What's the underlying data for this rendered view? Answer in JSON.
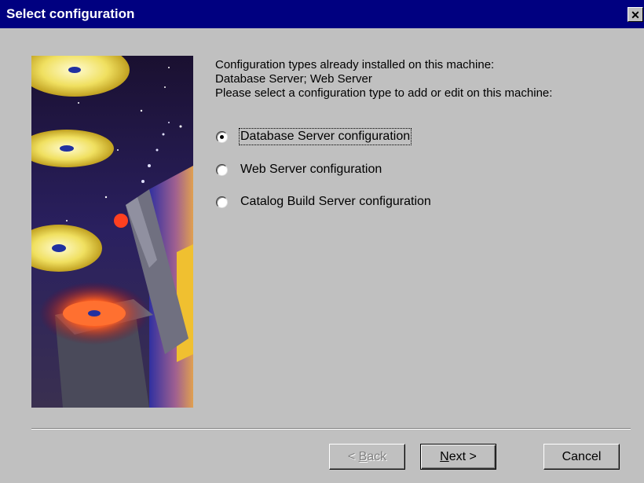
{
  "window": {
    "title": "Select configuration",
    "close_symbol": "✕"
  },
  "intro": {
    "line1": "Configuration types already installed on this machine:",
    "line2": "Database Server; Web Server",
    "line3": "Please select a configuration type to add or edit on this machine:"
  },
  "options": [
    {
      "label": "Database Server configuration",
      "checked": true
    },
    {
      "label": "Web Server configuration",
      "checked": false
    },
    {
      "label": "Catalog Build Server configuration",
      "checked": false
    }
  ],
  "buttons": {
    "back_prefix": "< ",
    "back_access": "B",
    "back_rest": "ack",
    "next_access": "N",
    "next_rest": "ext >",
    "cancel": "Cancel"
  },
  "icons": {
    "wizard_art": "cd-discs-illustration",
    "close": "close-icon",
    "radio": "radio-button"
  },
  "colors": {
    "titlebar": "#000080",
    "dialog": "#c0c0c0",
    "disabled_text": "#808080"
  }
}
